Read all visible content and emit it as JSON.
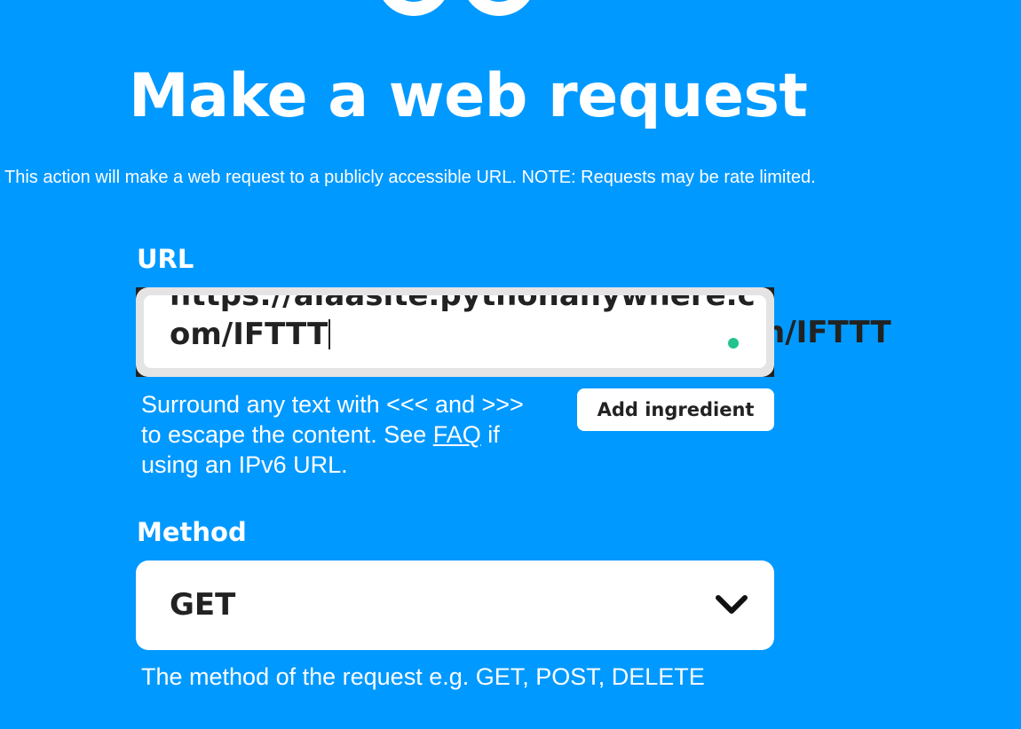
{
  "app": {
    "logo_icon": "service-logo-icon"
  },
  "header": {
    "title": "Make a web request",
    "description": "This action will make a web request to a publicly accessible URL. NOTE: Requests may be rate limited."
  },
  "url_field": {
    "label": "URL",
    "value_line_1": "https://aiaasite.pythonanywhere.c",
    "value_line_2": "om/IFTTT",
    "overflow_text": "n/IFTTT",
    "status_icon": "status-dot-icon",
    "helper_text_before_link": "Surround any text with <<< and >>> to escape the content. See ",
    "helper_link_label": "FAQ",
    "helper_text_after_link": " if using an IPv6 URL.",
    "add_ingredient_label": "Add ingredient"
  },
  "method_field": {
    "label": "Method",
    "value": "GET",
    "dropdown_icon": "chevron-down-icon",
    "helper_text": "The method of the request e.g. GET, POST, DELETE"
  },
  "colors": {
    "background": "#0099ff",
    "text_light": "#ffffff",
    "text_dark": "#222222",
    "field_border": "#e4e4e4",
    "status_dot": "#22c38e"
  }
}
